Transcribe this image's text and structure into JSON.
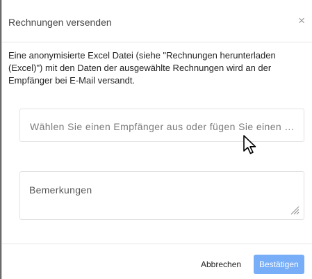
{
  "dialog": {
    "title": "Rechnungen versenden",
    "close_glyph": "×",
    "description": "Eine anonymisierte Excel Datei (siehe \"Rechnungen herunterladen (Excel)\") mit den Daten der ausgewählte Rechnungen wird an der Empfänger bei E-Mail versandt.",
    "recipient_placeholder": "Wählen Sie einen Empfänger aus oder fügen Sie einen …",
    "remarks_placeholder": "Bemerkungen",
    "cancel_label": "Abbrechen",
    "confirm_label": "Bestätigen"
  },
  "icons": {
    "close": "close-icon",
    "cursor": "mouse-cursor-icon",
    "resize": "resize-handle-icon"
  },
  "colors": {
    "confirm_bg": "#77aef7",
    "border": "#e2e2e2"
  }
}
